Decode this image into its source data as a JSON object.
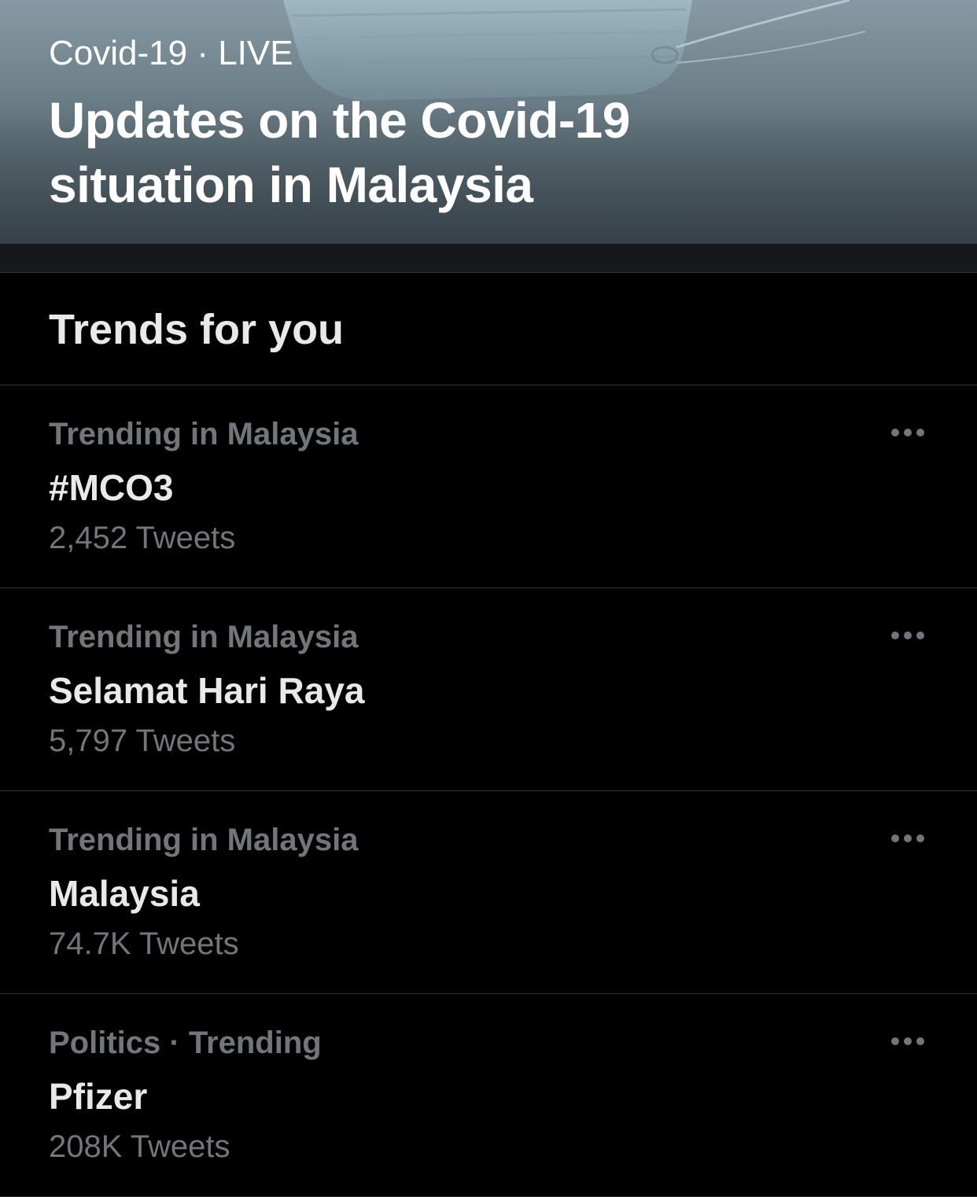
{
  "hero": {
    "kicker": "Covid-19 · LIVE",
    "title": "Updates on the Covid-19 situation in Malaysia"
  },
  "trends": {
    "header": "Trends for you",
    "items": [
      {
        "context": "Trending in Malaysia",
        "name": "#MCO3",
        "count": "2,452 Tweets"
      },
      {
        "context": "Trending in Malaysia",
        "name": "Selamat Hari Raya",
        "count": "5,797 Tweets"
      },
      {
        "context": "Trending in Malaysia",
        "name": "Malaysia",
        "count": "74.7K Tweets"
      },
      {
        "context": "Politics · Trending",
        "name": "Pfizer",
        "count": "208K Tweets"
      }
    ]
  },
  "icons": {
    "more": "more-horizontal-icon"
  },
  "colors": {
    "background": "#000000",
    "primary_text": "#e7e9ea",
    "secondary_text": "#71767b",
    "divider": "#2f3336"
  }
}
